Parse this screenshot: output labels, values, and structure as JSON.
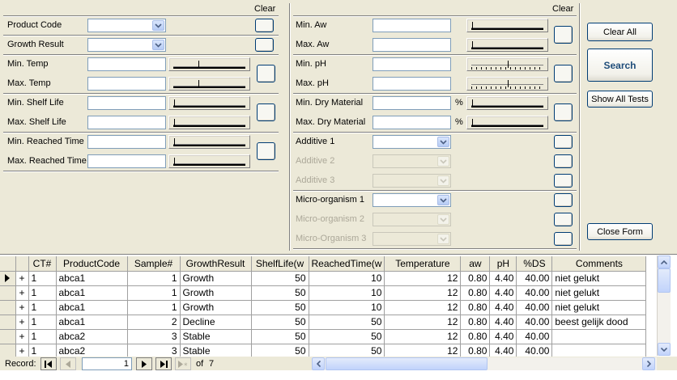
{
  "filters": {
    "left_clear_label": "Clear",
    "right_clear_label": "Clear",
    "product_code_label": "Product Code",
    "growth_result_label": "Growth Result",
    "min_temp_label": "Min. Temp",
    "max_temp_label": "Max. Temp",
    "min_shelf_label": "Min. Shelf Life",
    "max_shelf_label": "Max. Shelf Life",
    "min_reached_label": "Min. Reached Time",
    "max_reached_label": "Max. Reached Time",
    "min_aw_label": "Min. Aw",
    "max_aw_label": "Max. Aw",
    "min_ph_label": "Min. pH",
    "max_ph_label": "Max. pH",
    "min_dry_label": "Min. Dry Material",
    "max_dry_label": "Max. Dry Material",
    "percent_unit": "%",
    "additive1_label": "Additive 1",
    "additive2_label": "Additive 2",
    "additive3_label": "Additive 3",
    "micro1_label": "Micro-organism 1",
    "micro2_label": "Micro-organism 2",
    "micro3_label": "Micro-Organism 3"
  },
  "actions": {
    "clear_all": "Clear All",
    "search": "Search",
    "show_all_tests": "Show All Tests",
    "close_form": "Close Form"
  },
  "grid": {
    "headers": [
      "CT#",
      "ProductCode",
      "Sample#",
      "GrowthResult",
      "ShelfLife(w",
      "ReachedTime(w",
      "Temperature",
      "aw",
      "pH",
      "%DS",
      "Comments"
    ],
    "rows": [
      {
        "exp": "+",
        "ct": "1",
        "product": "abca1",
        "sample": "1",
        "growth": "Growth",
        "shelf": "50",
        "reached": "10",
        "temp": "12",
        "aw": "0.80",
        "ph": "4.40",
        "ds": "40.00",
        "comments": "niet gelukt"
      },
      {
        "exp": "+",
        "ct": "1",
        "product": "abca1",
        "sample": "1",
        "growth": "Growth",
        "shelf": "50",
        "reached": "10",
        "temp": "12",
        "aw": "0.80",
        "ph": "4.40",
        "ds": "40.00",
        "comments": "niet gelukt"
      },
      {
        "exp": "+",
        "ct": "1",
        "product": "abca1",
        "sample": "1",
        "growth": "Growth",
        "shelf": "50",
        "reached": "10",
        "temp": "12",
        "aw": "0.80",
        "ph": "4.40",
        "ds": "40.00",
        "comments": "niet gelukt"
      },
      {
        "exp": "+",
        "ct": "1",
        "product": "abca1",
        "sample": "2",
        "growth": "Decline",
        "shelf": "50",
        "reached": "50",
        "temp": "12",
        "aw": "0.80",
        "ph": "4.40",
        "ds": "40.00",
        "comments": "beest gelijk dood"
      },
      {
        "exp": "+",
        "ct": "1",
        "product": "abca2",
        "sample": "3",
        "growth": "Stable",
        "shelf": "50",
        "reached": "50",
        "temp": "12",
        "aw": "0.80",
        "ph": "4.40",
        "ds": "40.00",
        "comments": ""
      },
      {
        "exp": "+",
        "ct": "1",
        "product": "abca2",
        "sample": "3",
        "growth": "Stable",
        "shelf": "50",
        "reached": "50",
        "temp": "12",
        "aw": "0.80",
        "ph": "4.40",
        "ds": "40.00",
        "comments": ""
      }
    ]
  },
  "navigator": {
    "record_label": "Record:",
    "current": "1",
    "of_label": "of",
    "total": "7"
  },
  "colors": {
    "button_border": "#003c74",
    "field_border": "#7f9db9",
    "form_bg": "#ece9d8"
  }
}
